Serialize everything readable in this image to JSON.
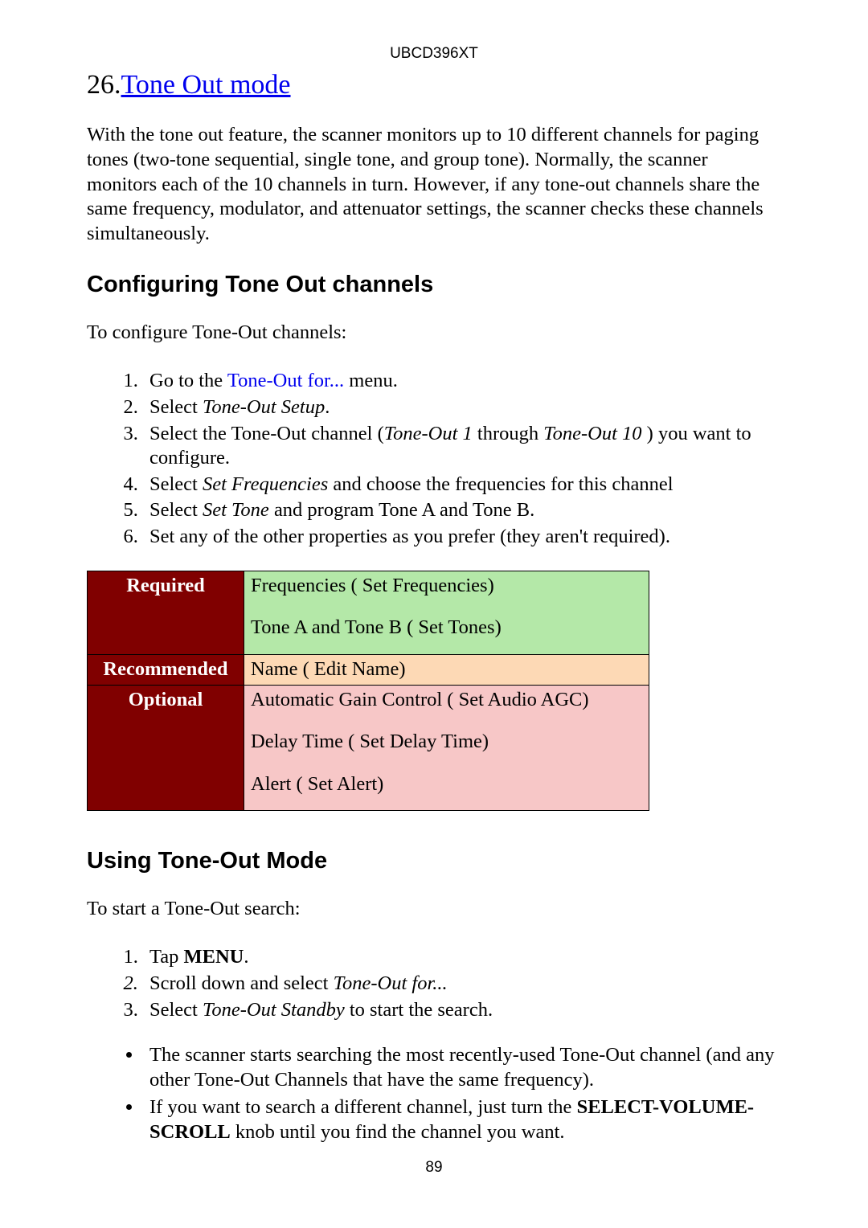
{
  "header_model": "UBCD396XT",
  "title_number": "26.",
  "title_text": "Tone Out mode",
  "intro_paragraph": "With the tone out feature, the scanner monitors up to 10 different channels for paging tones (two-tone sequential, single tone, and group tone). Normally, the scanner monitors each of the 10 channels in turn. However, if any tone-out channels share the same frequency, modulator, and attenuator settings, the scanner checks these channels simultaneously.",
  "section1_heading": "Configuring Tone Out channels",
  "section1_intro": "To configure Tone-Out channels:",
  "steps1": {
    "s1_pre": "Go to the ",
    "s1_link": "Tone-Out for...",
    "s1_post": " menu.",
    "s2_pre": "Select ",
    "s2_it": "Tone-Out Setup",
    "s2_post": ".",
    "s3_pre": "Select the Tone-Out channel (",
    "s3_it1": "Tone-Out 1",
    "s3_mid": " through ",
    "s3_it2": "Tone-Out 10",
    "s3_post": " ) you want to configure.",
    "s4_pre": "Select ",
    "s4_it": "Set Frequencies",
    "s4_post": " and choose the frequencies for this channel",
    "s5_pre": "Select ",
    "s5_it": "Set Tone",
    "s5_post": " and program Tone A and Tone B.",
    "s6": "Set any of the other properties as you prefer (they aren't required)."
  },
  "table": {
    "row_required_label": "Required",
    "row_required_line1": "Frequencies ( Set Frequencies)",
    "row_required_line2": "Tone A and Tone B ( Set Tones)",
    "row_recommended_label": "Recommended",
    "row_recommended_value": "Name ( Edit Name)",
    "row_optional_label": "Optional",
    "row_optional_line1": "Automatic Gain Control ( Set Audio AGC)",
    "row_optional_line2": "Delay Time ( Set Delay Time)",
    "row_optional_line3": "Alert ( Set Alert)"
  },
  "section2_heading": "Using Tone-Out Mode",
  "section2_intro": "To start a Tone-Out search:",
  "steps2": {
    "s1_pre": "Tap ",
    "s1_bold": "MENU",
    "s1_post": ".",
    "s2_pre": "Scroll down and select ",
    "s2_it": "Tone-Out for...",
    "s3_pre": "Select ",
    "s3_it": "Tone-Out Standby",
    "s3_post": " to start the search."
  },
  "bullets": {
    "b1": "The scanner starts searching the most recently-used Tone-Out channel (and any other Tone-Out Channels that have the same frequency).",
    "b2_pre": "If you want to search a different channel, just turn the ",
    "b2_bold": "SELECT-VOLUME-SCROLL",
    "b2_post": " knob until you find the channel you want."
  },
  "page_number": "89"
}
